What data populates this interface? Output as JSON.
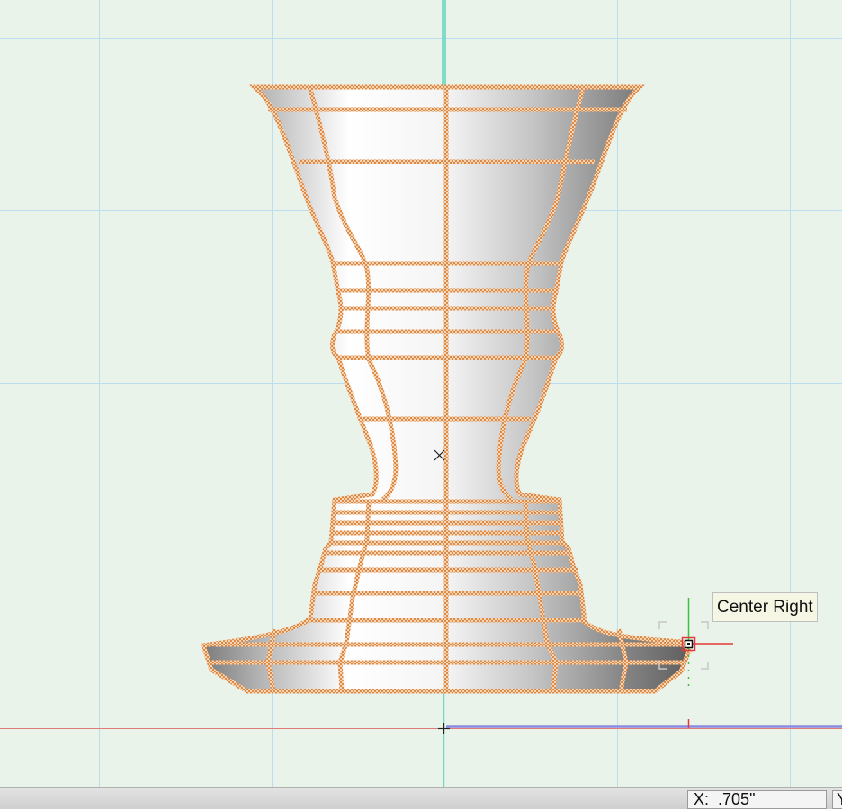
{
  "tooltip": {
    "snap_label": "Center Right"
  },
  "status_bar": {
    "x_label": "X:",
    "x_value": ".705\"",
    "y_label": "Y"
  },
  "colors": {
    "background": "#eaf3ea",
    "grid_line": "#bcdcf0",
    "selection_outline": "#e8a461",
    "axis_vertical": "#74d9c4",
    "axis_horizontal": "#e07b7b",
    "snap_red": "#e23a3a",
    "snap_green": "#3cbf3c"
  },
  "icons": [
    "crosshair-icon",
    "center-x-icon",
    "snap-point-icon"
  ]
}
